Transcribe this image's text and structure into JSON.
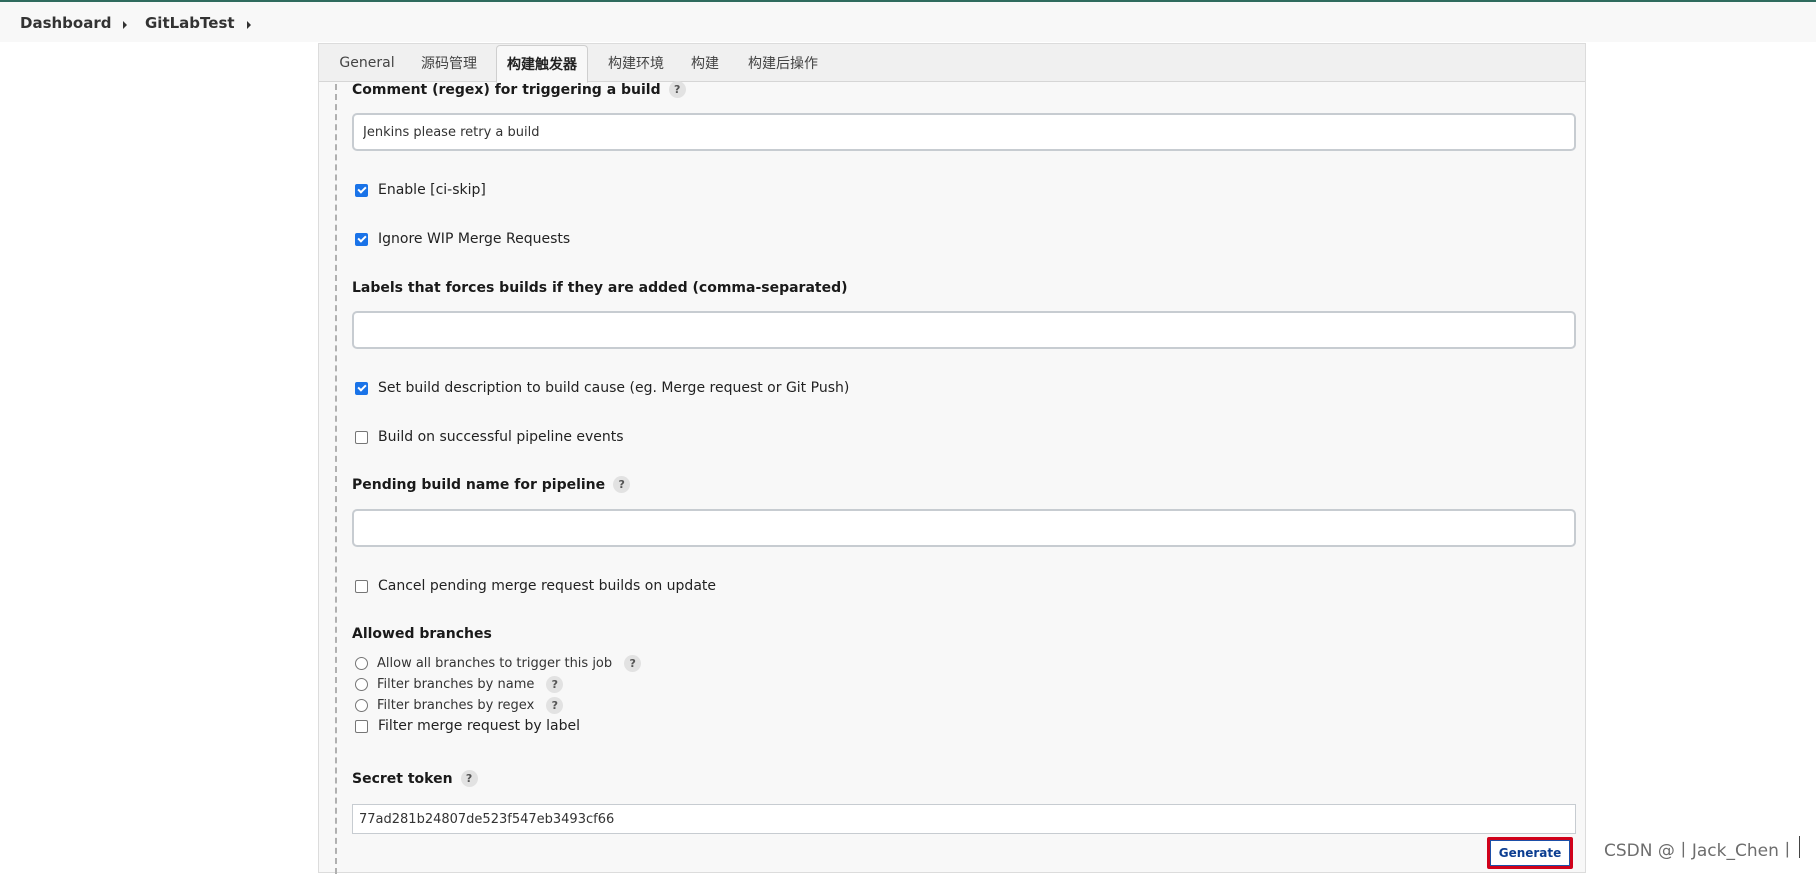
{
  "breadcrumb": {
    "dashboard": "Dashboard",
    "job": "GitLabTest"
  },
  "tabs": [
    {
      "label": "General",
      "active": false
    },
    {
      "label": "源码管理",
      "active": false
    },
    {
      "label": "构建触发器",
      "active": true
    },
    {
      "label": "构建环境",
      "active": false
    },
    {
      "label": "构建",
      "active": false
    },
    {
      "label": "构建后操作",
      "active": false
    }
  ],
  "form": {
    "comment_regex_label": "Comment (regex) for triggering a build",
    "comment_regex_value": "Jenkins please retry a build",
    "enable_ci_skip_label": "Enable [ci-skip]",
    "enable_ci_skip_checked": true,
    "ignore_wip_label": "Ignore WIP Merge Requests",
    "ignore_wip_checked": true,
    "labels_force_label": "Labels that forces builds if they are added (comma-separated)",
    "labels_force_value": "",
    "set_build_desc_label": "Set build description to build cause (eg. Merge request or Git Push)",
    "set_build_desc_checked": true,
    "build_pipeline_label": "Build on successful pipeline events",
    "build_pipeline_checked": false,
    "pending_build_name_label": "Pending build name for pipeline",
    "pending_build_name_value": "",
    "cancel_pending_label": "Cancel pending merge request builds on update",
    "cancel_pending_checked": false,
    "allowed_branches_label": "Allowed branches",
    "branch_options": [
      "Allow all branches to trigger this job",
      "Filter branches by name",
      "Filter branches by regex"
    ],
    "filter_mr_label": "Filter merge request by label",
    "secret_token_label": "Secret token",
    "secret_token_value": "77ad281b24807de523f547eb3493cf66",
    "generate_label": "Generate",
    "help_glyph": "?"
  },
  "watermark": "CSDN @丨Jack_Chen丨",
  "colors": {
    "accent_checkbox": "#1a73e8",
    "highlight_box": "#d0021b",
    "top_line": "#2f6b5e"
  }
}
